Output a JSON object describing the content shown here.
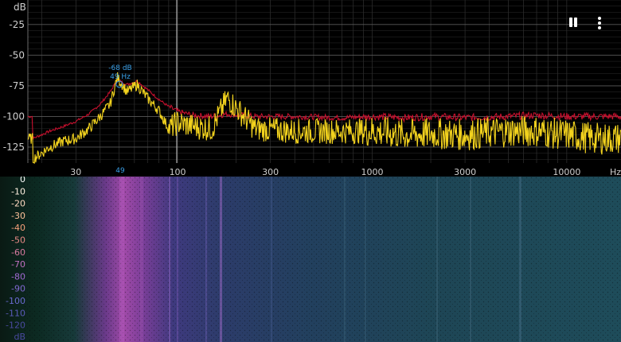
{
  "spectrum": {
    "y_unit": "dB",
    "y_ticks": [
      "-25",
      "-50",
      "-75",
      "-100",
      "-125"
    ],
    "x_ticks": [
      "30",
      "100",
      "300",
      "1000",
      "3000",
      "10000"
    ],
    "x_unit": "Hz",
    "peak": {
      "level_label": "-68 dB",
      "freq_label": "49 Hz",
      "axis_marker": "49"
    },
    "colors": {
      "fft": "#f3d31e",
      "peak_hold": "#c8102e",
      "peak_marker": "#3aa0e8",
      "grid": "#3a3a3a"
    }
  },
  "toolbar": {
    "pause_icon": "pause-icon",
    "more_icon": "more-vert-icon"
  },
  "spectrogram": {
    "scale_labels": [
      "0",
      "-10",
      "-20",
      "-30",
      "-40",
      "-50",
      "-60",
      "-70",
      "-80",
      "-90",
      "-100",
      "-110",
      "-120"
    ],
    "scale_colors": [
      "#ffffff",
      "#fff0e0",
      "#ffd9c0",
      "#ffc29a",
      "#f7a07a",
      "#e98a86",
      "#d97aa0",
      "#c070c0",
      "#a068d0",
      "#8068d0",
      "#6a6ad0",
      "#5a5ab8",
      "#4a4aa0"
    ],
    "unit": "dB"
  },
  "chart_data": {
    "type": "line",
    "xlabel": "Hz",
    "ylabel": "dB",
    "x_scale": "log",
    "xlim": [
      17,
      19000
    ],
    "ylim": [
      -138,
      -5
    ],
    "series": [
      {
        "x": [
          18,
          22,
          26,
          30,
          35,
          40,
          45,
          49,
          55,
          62,
          70,
          80,
          90,
          100,
          120,
          150,
          180,
          250,
          400,
          700,
          1000,
          1500,
          2000,
          3000,
          5000,
          7000,
          10000,
          14000,
          19000
        ],
        "y": [
          -118,
          -112,
          -108,
          -104,
          -98,
          -90,
          -80,
          -70,
          -74,
          -71,
          -78,
          -86,
          -92,
          -96,
          -99,
          -100,
          -98,
          -100,
          -100,
          -101,
          -100,
          -101,
          -100,
          -101,
          -100,
          -99,
          -100,
          -100,
          -100
        ]
      },
      {
        "x": [
          18,
          22,
          26,
          30,
          35,
          40,
          45,
          49,
          55,
          62,
          70,
          80,
          90,
          100,
          120,
          150,
          180,
          250,
          400,
          700,
          1000,
          1500,
          2000,
          3000,
          5000,
          7000,
          10000,
          14000,
          19000
        ],
        "y": [
          -135,
          -125,
          -120,
          -118,
          -110,
          -100,
          -90,
          -68,
          -80,
          -74,
          -85,
          -95,
          -110,
          -105,
          -108,
          -110,
          -85,
          -110,
          -112,
          -112,
          -112,
          -115,
          -114,
          -115,
          -112,
          -112,
          -115,
          -118,
          -118
        ]
      }
    ]
  }
}
